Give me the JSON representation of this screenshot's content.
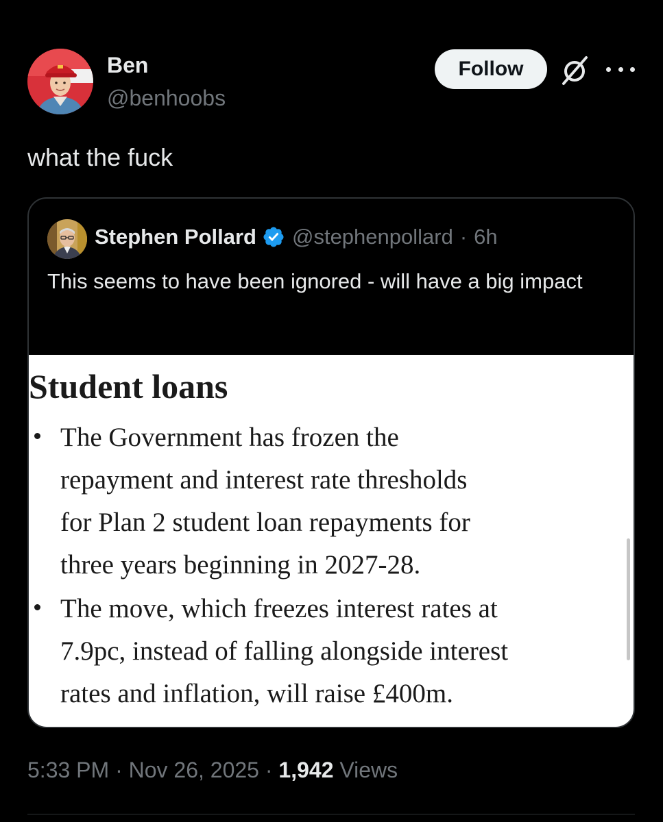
{
  "author": {
    "name": "Ben",
    "handle": "@benhoobs"
  },
  "header_actions": {
    "follow_label": "Follow",
    "grok_icon": "grok-slash-icon",
    "more_icon": "more-horizontal-icon"
  },
  "tweet": {
    "text": "what the fuck"
  },
  "quoted_tweet": {
    "name": "Stephen Pollard",
    "verified": true,
    "handle": "@stephenpollard",
    "separator": "·",
    "time": "6h",
    "text": "This seems to have been ignored - will have a big impact",
    "image": {
      "heading": "Student loans",
      "bullets": [
        {
          "lines": [
            "The Government has frozen the",
            "repayment and interest rate thresholds",
            "for Plan 2 student loan repayments for",
            "three years beginning in 2027-28."
          ]
        },
        {
          "lines": [
            "The move, which freezes interest rates at",
            "7.9pc, instead of falling alongside interest",
            "rates and inflation, will raise £400m."
          ]
        }
      ]
    }
  },
  "meta": {
    "time": "5:33 PM",
    "separator": "·",
    "date": "Nov 26, 2025",
    "views_count": "1,942",
    "views_label": "Views"
  },
  "colors": {
    "background": "#000000",
    "primary_text": "#e7e9ea",
    "secondary_text": "#71767b",
    "border": "#2f3336",
    "verified_blue": "#1d9bf0",
    "follow_button_bg": "#eff3f4"
  }
}
